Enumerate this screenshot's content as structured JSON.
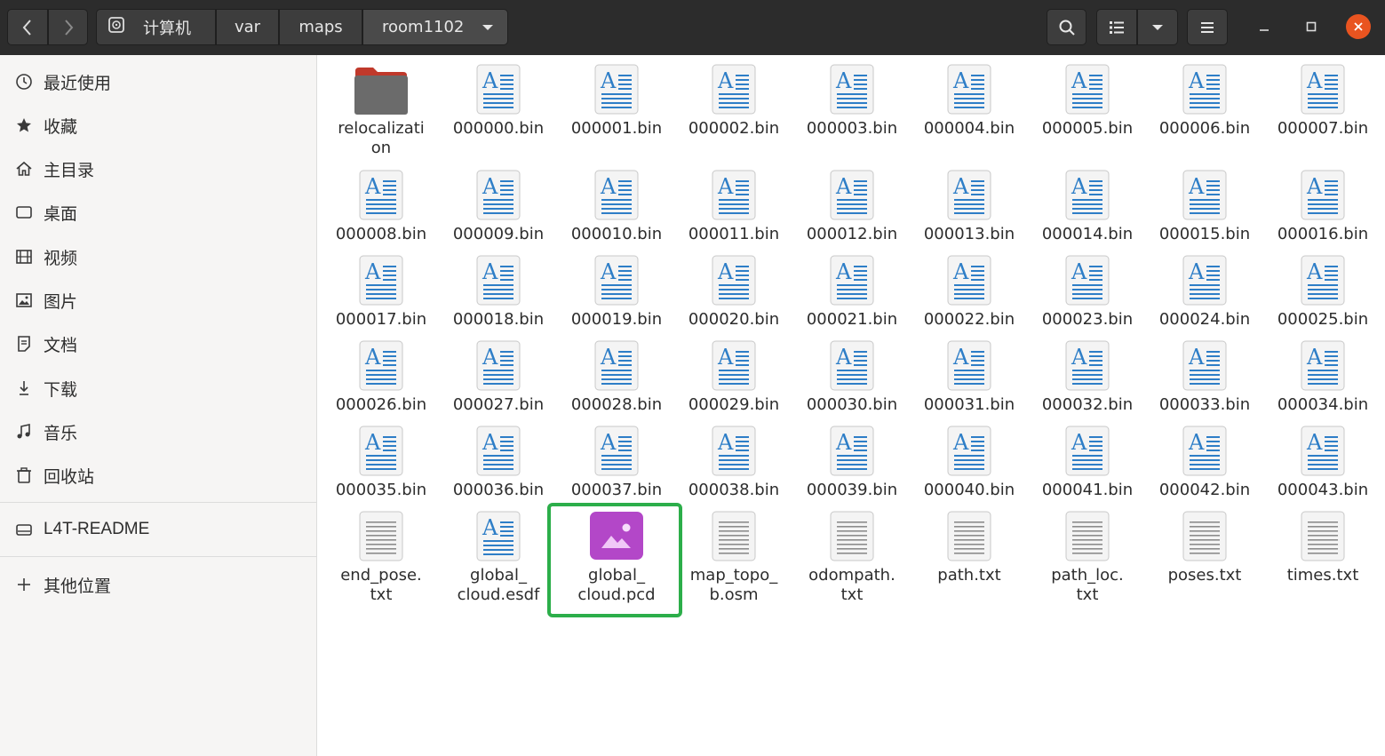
{
  "header": {
    "path": [
      "计算机",
      "var",
      "maps",
      "room1102"
    ],
    "icons": {
      "back": "chevron-left-icon",
      "forward": "chevron-right-icon",
      "search": "search-icon",
      "view": "list-view-icon",
      "view_menu": "chevron-down-icon",
      "menu": "hamburger-menu-icon",
      "minimize": "minimize-icon",
      "maximize": "maximize-icon",
      "close": "close-icon"
    },
    "close_color": "#e95420"
  },
  "sidebar": {
    "places": [
      {
        "label": "最近使用",
        "icon": "clock-icon"
      },
      {
        "label": "收藏",
        "icon": "star-icon"
      },
      {
        "label": "主目录",
        "icon": "home-icon"
      },
      {
        "label": "桌面",
        "icon": "desktop-icon"
      },
      {
        "label": "视频",
        "icon": "video-icon"
      },
      {
        "label": "图片",
        "icon": "picture-icon"
      },
      {
        "label": "文档",
        "icon": "document-icon"
      },
      {
        "label": "下载",
        "icon": "download-icon"
      },
      {
        "label": "音乐",
        "icon": "music-icon"
      },
      {
        "label": "回收站",
        "icon": "trash-icon"
      }
    ],
    "devices": [
      {
        "label": "L4T-README",
        "icon": "drive-icon"
      }
    ],
    "other": {
      "label": "其他位置",
      "icon": "plus-icon"
    }
  },
  "files": [
    {
      "name": "relocalizati\non",
      "type": "folder"
    },
    {
      "name": "000000.bin",
      "type": "text"
    },
    {
      "name": "000001.bin",
      "type": "text"
    },
    {
      "name": "000002.bin",
      "type": "text"
    },
    {
      "name": "000003.bin",
      "type": "text"
    },
    {
      "name": "000004.bin",
      "type": "text"
    },
    {
      "name": "000005.bin",
      "type": "text"
    },
    {
      "name": "000006.bin",
      "type": "text"
    },
    {
      "name": "000007.bin",
      "type": "text"
    },
    {
      "name": "000008.bin",
      "type": "text"
    },
    {
      "name": "000009.bin",
      "type": "text"
    },
    {
      "name": "000010.bin",
      "type": "text"
    },
    {
      "name": "000011.bin",
      "type": "text"
    },
    {
      "name": "000012.bin",
      "type": "text"
    },
    {
      "name": "000013.bin",
      "type": "text"
    },
    {
      "name": "000014.bin",
      "type": "text"
    },
    {
      "name": "000015.bin",
      "type": "text"
    },
    {
      "name": "000016.bin",
      "type": "text"
    },
    {
      "name": "000017.bin",
      "type": "text"
    },
    {
      "name": "000018.bin",
      "type": "text"
    },
    {
      "name": "000019.bin",
      "type": "text"
    },
    {
      "name": "000020.bin",
      "type": "text"
    },
    {
      "name": "000021.bin",
      "type": "text"
    },
    {
      "name": "000022.bin",
      "type": "text"
    },
    {
      "name": "000023.bin",
      "type": "text"
    },
    {
      "name": "000024.bin",
      "type": "text"
    },
    {
      "name": "000025.bin",
      "type": "text"
    },
    {
      "name": "000026.bin",
      "type": "text"
    },
    {
      "name": "000027.bin",
      "type": "text"
    },
    {
      "name": "000028.bin",
      "type": "text"
    },
    {
      "name": "000029.bin",
      "type": "text"
    },
    {
      "name": "000030.bin",
      "type": "text"
    },
    {
      "name": "000031.bin",
      "type": "text"
    },
    {
      "name": "000032.bin",
      "type": "text"
    },
    {
      "name": "000033.bin",
      "type": "text"
    },
    {
      "name": "000034.bin",
      "type": "text"
    },
    {
      "name": "000035.bin",
      "type": "text"
    },
    {
      "name": "000036.bin",
      "type": "text"
    },
    {
      "name": "000037.bin",
      "type": "text"
    },
    {
      "name": "000038.bin",
      "type": "text"
    },
    {
      "name": "000039.bin",
      "type": "text"
    },
    {
      "name": "000040.bin",
      "type": "text"
    },
    {
      "name": "000041.bin",
      "type": "text"
    },
    {
      "name": "000042.bin",
      "type": "text"
    },
    {
      "name": "000043.bin",
      "type": "text"
    },
    {
      "name": "end_pose.\ntxt",
      "type": "plain"
    },
    {
      "name": "global_\ncloud.esdf",
      "type": "text"
    },
    {
      "name": "global_\ncloud.pcd",
      "type": "image",
      "highlighted": true
    },
    {
      "name": "map_topo_\nb.osm",
      "type": "plain"
    },
    {
      "name": "odompath.\ntxt",
      "type": "plain"
    },
    {
      "name": "path.txt",
      "type": "plain"
    },
    {
      "name": "path_loc.\ntxt",
      "type": "plain"
    },
    {
      "name": "poses.txt",
      "type": "plain"
    },
    {
      "name": "times.txt",
      "type": "plain"
    }
  ],
  "colors": {
    "highlight_border": "#2cae4a",
    "folder": "#6b6b6b",
    "folder_tab": "#c0392b",
    "doc_blue": "#2e7ec7",
    "image_icon": "#b347c8"
  }
}
